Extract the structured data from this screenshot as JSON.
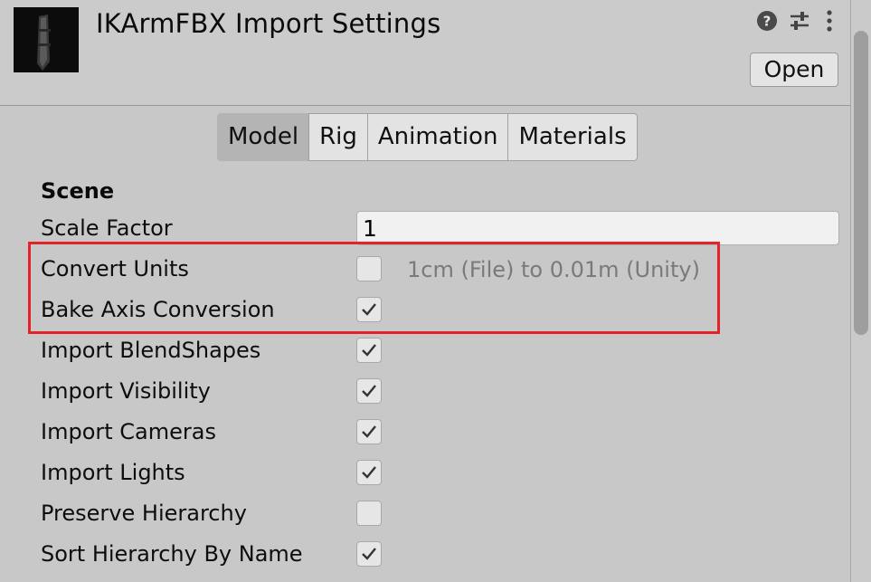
{
  "header": {
    "title": "IKArmFBX Import Settings",
    "open_label": "Open",
    "icons": [
      "help-icon",
      "preset-sliders-icon",
      "more-vert-icon"
    ]
  },
  "tabs": [
    {
      "label": "Model",
      "active": true
    },
    {
      "label": "Rig",
      "active": false
    },
    {
      "label": "Animation",
      "active": false
    },
    {
      "label": "Materials",
      "active": false
    }
  ],
  "scene": {
    "section_title": "Scene",
    "scale_factor_label": "Scale Factor",
    "scale_factor_value": "1",
    "convert_units_label": "Convert Units",
    "convert_units_hint": "1cm (File) to 0.01m (Unity)",
    "rows": [
      {
        "label": "Convert Units",
        "checked": false
      },
      {
        "label": "Bake Axis Conversion",
        "checked": true
      },
      {
        "label": "Import BlendShapes",
        "checked": true
      },
      {
        "label": "Import Visibility",
        "checked": true
      },
      {
        "label": "Import Cameras",
        "checked": true
      },
      {
        "label": "Import Lights",
        "checked": true
      },
      {
        "label": "Preserve Hierarchy",
        "checked": false
      },
      {
        "label": "Sort Hierarchy By Name",
        "checked": true
      }
    ]
  },
  "colors": {
    "highlight": "#e3222a",
    "background": "#c8c8c8",
    "active_tab": "#b4b4b4"
  }
}
